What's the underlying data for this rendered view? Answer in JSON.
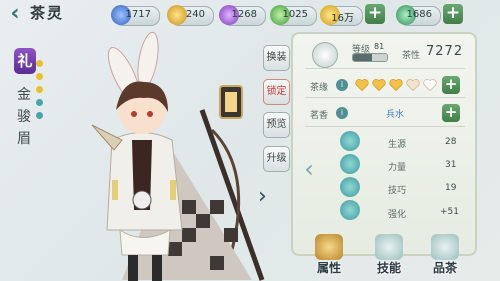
{
  "header": {
    "title": "茶灵",
    "resources": [
      {
        "value": "1717",
        "icon": "blue-gem-icon",
        "color": "#4a7fd4"
      },
      {
        "value": "240",
        "icon": "gold-coin-icon",
        "color": "#e2b32b"
      },
      {
        "value": "1268",
        "icon": "purple-crystal-icon",
        "color": "#a25cd6"
      },
      {
        "value": "1025",
        "icon": "green-leaf-icon",
        "color": "#5fb65a"
      },
      {
        "value": "16万",
        "icon": "gold-ingot-icon",
        "color": "#e9b423"
      },
      {
        "value": "1686",
        "icon": "jade-leaf-icon",
        "color": "#45a468"
      }
    ]
  },
  "character": {
    "badge": "礼",
    "name_chars": [
      "金",
      "骏",
      "眉"
    ]
  },
  "side_buttons": [
    "换装",
    "锁定",
    "预览",
    "升级"
  ],
  "panel": {
    "level_label": "等级",
    "level_value": "81",
    "level_progress": 0.55,
    "tea_label": "茶性",
    "tea_value": "7272",
    "bond_label": "茶缘",
    "hearts_filled": 3,
    "hearts_total": 5,
    "fragrance_label": "茗香",
    "fragrance_value": "兵水",
    "stats": [
      {
        "label": "生源",
        "value": "28",
        "icon": "vitality-icon"
      },
      {
        "label": "力量",
        "value": "31",
        "icon": "strength-icon"
      },
      {
        "label": "技巧",
        "value": "19",
        "icon": "skill-icon"
      },
      {
        "label": "强化",
        "value": "+51",
        "icon": "enhance-icon"
      }
    ]
  },
  "tabs": [
    "属性",
    "技能",
    "品茶"
  ]
}
